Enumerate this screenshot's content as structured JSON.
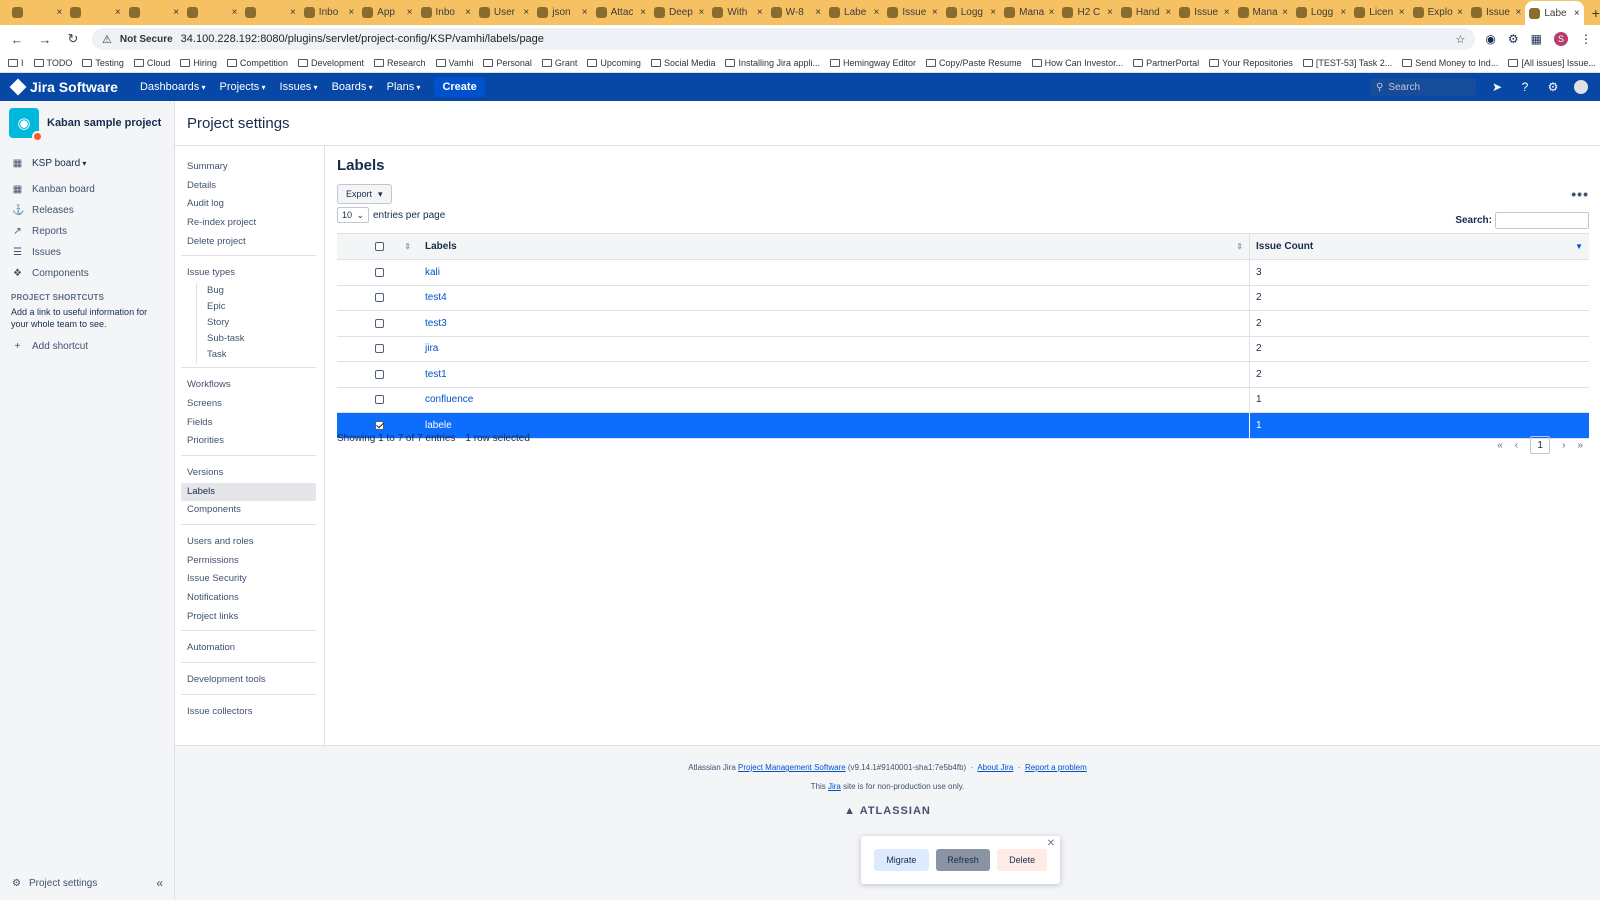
{
  "browser": {
    "tabs": [
      {
        "title": "",
        "active": false
      },
      {
        "title": "",
        "active": false
      },
      {
        "title": "",
        "active": false
      },
      {
        "title": "",
        "active": false
      },
      {
        "title": "",
        "active": false
      },
      {
        "title": "Inbo",
        "active": false
      },
      {
        "title": "App",
        "active": false
      },
      {
        "title": "Inbo",
        "active": false
      },
      {
        "title": "User",
        "active": false
      },
      {
        "title": "json",
        "active": false
      },
      {
        "title": "Attac",
        "active": false
      },
      {
        "title": "Deep",
        "active": false
      },
      {
        "title": "With",
        "active": false
      },
      {
        "title": "W-8",
        "active": false
      },
      {
        "title": "Labe",
        "active": false
      },
      {
        "title": "Issue",
        "active": false
      },
      {
        "title": "Logg",
        "active": false
      },
      {
        "title": "Mana",
        "active": false
      },
      {
        "title": "H2 C",
        "active": false
      },
      {
        "title": "Hand",
        "active": false
      },
      {
        "title": "Issue",
        "active": false
      },
      {
        "title": "Mana",
        "active": false
      },
      {
        "title": "Logg",
        "active": false
      },
      {
        "title": "Licen",
        "active": false
      },
      {
        "title": "Explo",
        "active": false
      },
      {
        "title": "Issue",
        "active": false
      },
      {
        "title": "Labe",
        "active": true
      }
    ],
    "not_secure": "Not Secure",
    "url": "34.100.228.192:8080/plugins/servlet/project-config/KSP/vamhi/labels/page",
    "bookmarks": [
      "I",
      "TODO",
      "Testing",
      "Cloud",
      "Hiring",
      "Competition",
      "Development",
      "Research",
      "Vamhi",
      "Personal",
      "Grant",
      "Upcoming",
      "Social Media",
      "Installing Jira appli...",
      "Hemingway Editor",
      "Copy/Paste Resume",
      "How Can Investor...",
      "PartnerPortal",
      "Your Repositories",
      "[TEST-53] Task 2...",
      "Send Money to Ind...",
      "[All issues] Issue..."
    ],
    "profile_initial": "S"
  },
  "jira_header": {
    "product": "Jira Software",
    "nav": [
      "Dashboards",
      "Projects",
      "Issues",
      "Boards",
      "Plans"
    ],
    "create": "Create",
    "search_placeholder": "Search"
  },
  "sidebar": {
    "project_name": "Kaban sample project",
    "board": "KSP board",
    "items": [
      {
        "label": "Kanban board",
        "icon": "board-icon"
      },
      {
        "label": "Releases",
        "icon": "ship-icon"
      },
      {
        "label": "Reports",
        "icon": "chart-icon"
      },
      {
        "label": "Issues",
        "icon": "issues-icon"
      },
      {
        "label": "Components",
        "icon": "component-icon"
      }
    ],
    "shortcuts_title": "PROJECT SHORTCUTS",
    "shortcuts_desc": "Add a link to useful information for your whole team to see.",
    "add_shortcut": "Add shortcut",
    "footer_label": "Project settings"
  },
  "page": {
    "title": "Project settings"
  },
  "settings_nav": {
    "group1": [
      "Summary",
      "Details",
      "Audit log",
      "Re-index project",
      "Delete project"
    ],
    "issue_types_label": "Issue types",
    "issue_types": [
      "Bug",
      "Epic",
      "Story",
      "Sub-task",
      "Task"
    ],
    "group3": [
      "Workflows",
      "Screens",
      "Fields",
      "Priorities"
    ],
    "group4": [
      "Versions",
      "Labels",
      "Components"
    ],
    "group5": [
      "Users and roles",
      "Permissions",
      "Issue Security",
      "Notifications",
      "Project links"
    ],
    "group6": [
      "Automation"
    ],
    "group7": [
      "Development tools"
    ],
    "group8": [
      "Issue collectors"
    ],
    "active": "Labels"
  },
  "labels_page": {
    "title": "Labels",
    "export": "Export",
    "per_page_value": "10",
    "per_page_label": "entries per page",
    "search_label": "Search:",
    "columns": [
      "Labels",
      "Issue Count"
    ],
    "rows": [
      {
        "label": "kali",
        "count": "3",
        "selected": false
      },
      {
        "label": "test4",
        "count": "2",
        "selected": false
      },
      {
        "label": "test3",
        "count": "2",
        "selected": false
      },
      {
        "label": "jira",
        "count": "2",
        "selected": false
      },
      {
        "label": "test1",
        "count": "2",
        "selected": false
      },
      {
        "label": "confluence",
        "count": "1",
        "selected": false
      },
      {
        "label": "labele",
        "count": "1",
        "selected": true
      }
    ],
    "showing": "Showing 1 to 7 of 7 entries",
    "selected_info": "1 row selected",
    "pager": {
      "first": "«",
      "prev": "‹",
      "current": "1",
      "next": "›",
      "last": "»"
    }
  },
  "footer": {
    "line1_prefix": "Atlassian Jira",
    "line1_link": "Project Management Software",
    "line1_version": "(v9.14.1#9140001-sha1:7e5b4fb)",
    "about": "About Jira",
    "report": "Report a problem",
    "line2_prefix": "This",
    "line2_link": "Jira",
    "line2_suffix": "site is for non-production use only.",
    "brand": "ATLASSIAN"
  },
  "popup": {
    "migrate": "Migrate",
    "refresh": "Refresh",
    "delete": "Delete"
  },
  "colors": {
    "jira_header": "#0747a6",
    "selected_row": "#0d6efd",
    "link": "#0052cc",
    "tab_strip": "#f5c163"
  }
}
